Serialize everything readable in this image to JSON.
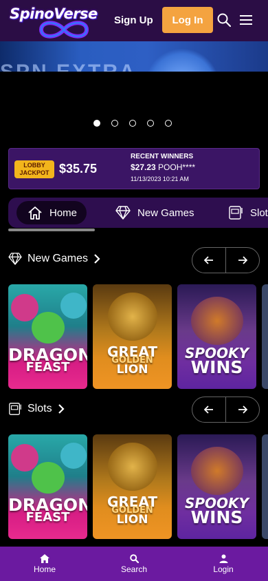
{
  "header": {
    "logo_text": "SpinoVerse",
    "signup_label": "Sign Up",
    "login_label": "Log In",
    "search_icon": "search-icon",
    "menu_icon": "hamburger-menu-icon"
  },
  "banner": {
    "text": "SPN EXTRA",
    "slide_count": 5,
    "active_slide": 1
  },
  "jackpot": {
    "logo_text": "LOBBY JACKPOT",
    "amount": "$35.75",
    "recent_title": "RECENT WINNERS",
    "recent_amount": "$27.23",
    "recent_user": "POOH****",
    "recent_date": "11/13/2023 10:21 AM"
  },
  "tabs": [
    {
      "label": "Home",
      "icon": "home-icon",
      "active": true
    },
    {
      "label": "New Games",
      "icon": "diamond-icon",
      "active": false
    },
    {
      "label": "Slots",
      "icon": "slot-machine-icon",
      "active": false
    }
  ],
  "sections": [
    {
      "title": "New Games",
      "icon": "diamond-icon",
      "games": [
        {
          "line1": "DRAGON",
          "line2": "FEAST"
        },
        {
          "line1": "GREAT",
          "line2": "GOLDEN",
          "line3": "LION"
        },
        {
          "line1": "SPOOKY",
          "line2": "WINS"
        }
      ]
    },
    {
      "title": "Slots",
      "icon": "slot-machine-icon",
      "games": [
        {
          "line1": "DRAGON",
          "line2": "FEAST"
        },
        {
          "line1": "GREAT",
          "line2": "GOLDEN",
          "line3": "LION"
        },
        {
          "line1": "SPOOKY",
          "line2": "WINS"
        }
      ]
    }
  ],
  "bottom_nav": [
    {
      "label": "Home",
      "icon": "home-icon"
    },
    {
      "label": "Search",
      "icon": "search-icon"
    },
    {
      "label": "Login",
      "icon": "user-icon"
    }
  ],
  "colors": {
    "header_bg": "#2b0d45",
    "accent": "#f4a340",
    "bottom_nav_bg": "#6b1aa0"
  }
}
